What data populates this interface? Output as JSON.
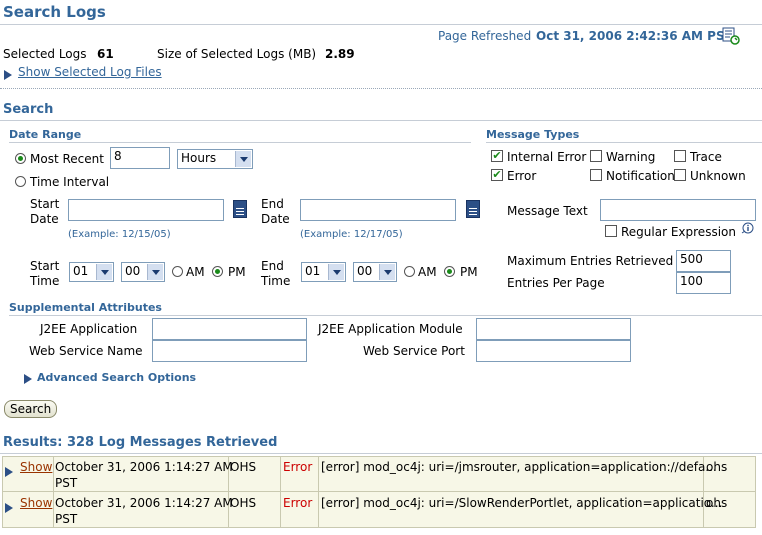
{
  "page": {
    "title": "Search Logs",
    "refreshed_label": "Page Refreshed",
    "refreshed_value": "Oct 31, 2006 2:42:36 AM PST",
    "selected_logs_label": "Selected Logs",
    "selected_logs_value": "61",
    "size_label": "Size of Selected Logs (MB)",
    "size_value": "2.89",
    "show_selected_link": "Show Selected Log Files"
  },
  "search": {
    "heading": "Search",
    "date_range": {
      "heading": "Date Range",
      "most_recent_label": "Most Recent",
      "most_recent_value": "8",
      "most_recent_unit": "Hours",
      "time_interval_label": "Time Interval",
      "start_date_label_1": "Start",
      "start_date_label_2": "Date",
      "start_example": "(Example: 12/15/05)",
      "end_date_label_1": "End",
      "end_date_label_2": "Date",
      "end_example": "(Example: 12/17/05)",
      "start_time_label_1": "Start",
      "start_time_label_2": "Time",
      "start_hour": "01",
      "start_min": "00",
      "end_time_label_1": "End",
      "end_time_label_2": "Time",
      "end_hour": "01",
      "end_min": "00",
      "am_label": "AM",
      "pm_label": "PM"
    },
    "message_types": {
      "heading": "Message Types",
      "internal_error": "Internal Error",
      "warning": "Warning",
      "trace": "Trace",
      "error": "Error",
      "notification": "Notification",
      "unknown": "Unknown"
    },
    "message_text_label": "Message Text",
    "regex_label": "Regular Expression",
    "max_entries_label": "Maximum Entries Retrieved",
    "max_entries_value": "500",
    "per_page_label": "Entries Per Page",
    "per_page_value": "100",
    "supplemental": {
      "heading": "Supplemental Attributes",
      "j2ee_app": "J2EE Application",
      "j2ee_module": "J2EE Application Module",
      "ws_name": "Web Service Name",
      "ws_port": "Web Service Port"
    },
    "advanced_link": "Advanced Search Options",
    "search_button": "Search"
  },
  "results": {
    "heading": "Results: 328 Log Messages Retrieved",
    "rows": [
      {
        "action": "Show",
        "time_1": "October 31, 2006 1:14:27 AM",
        "time_2": "PST",
        "component": "OHS",
        "type": "Error",
        "message": "[error] mod_oc4j: uri=/jmsrouter, application=application://defa...",
        "host": "ohs"
      },
      {
        "action": "Show",
        "time_1": "October 31, 2006 1:14:27 AM",
        "time_2": "PST",
        "component": "OHS",
        "type": "Error",
        "message": "[error] mod_oc4j: uri=/SlowRenderPortlet, application=applicatio...",
        "host": "ohs"
      }
    ]
  }
}
